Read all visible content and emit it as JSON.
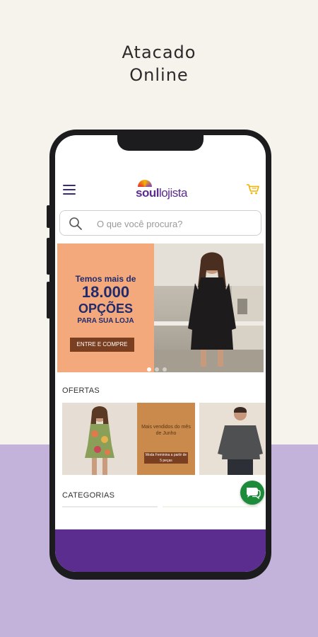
{
  "headline": {
    "line1": "Atacado",
    "line2": "Online"
  },
  "app": {
    "logo": {
      "part1": "soul",
      "part2": "lojista"
    },
    "search": {
      "placeholder": "O que você procura?"
    },
    "banner": {
      "line1": "Temos mais de",
      "line2": "18.000",
      "line3": "OPÇÕES",
      "line4": "PARA SUA LOJA",
      "cta": "ENTRE E COMPRE",
      "slides": 3,
      "active_slide": 0
    },
    "sections": {
      "offers": "OFERTAS",
      "categories": "CATEGORIAS"
    },
    "offer_card": {
      "text": "Mais vendidos do mês de Junho",
      "badge": "Moda Feminina a partir de 5 peças"
    }
  },
  "colors": {
    "brand_purple": "#5b2d8e",
    "banner_orange": "#f4a97d",
    "banner_navy": "#1f2b6c",
    "cta_brown": "#7a3e20",
    "whatsapp_green": "#1c8b3a",
    "cart_yellow": "#f2b300"
  },
  "icons": [
    "menu-icon",
    "cart-icon",
    "search-icon",
    "chat-icon"
  ]
}
